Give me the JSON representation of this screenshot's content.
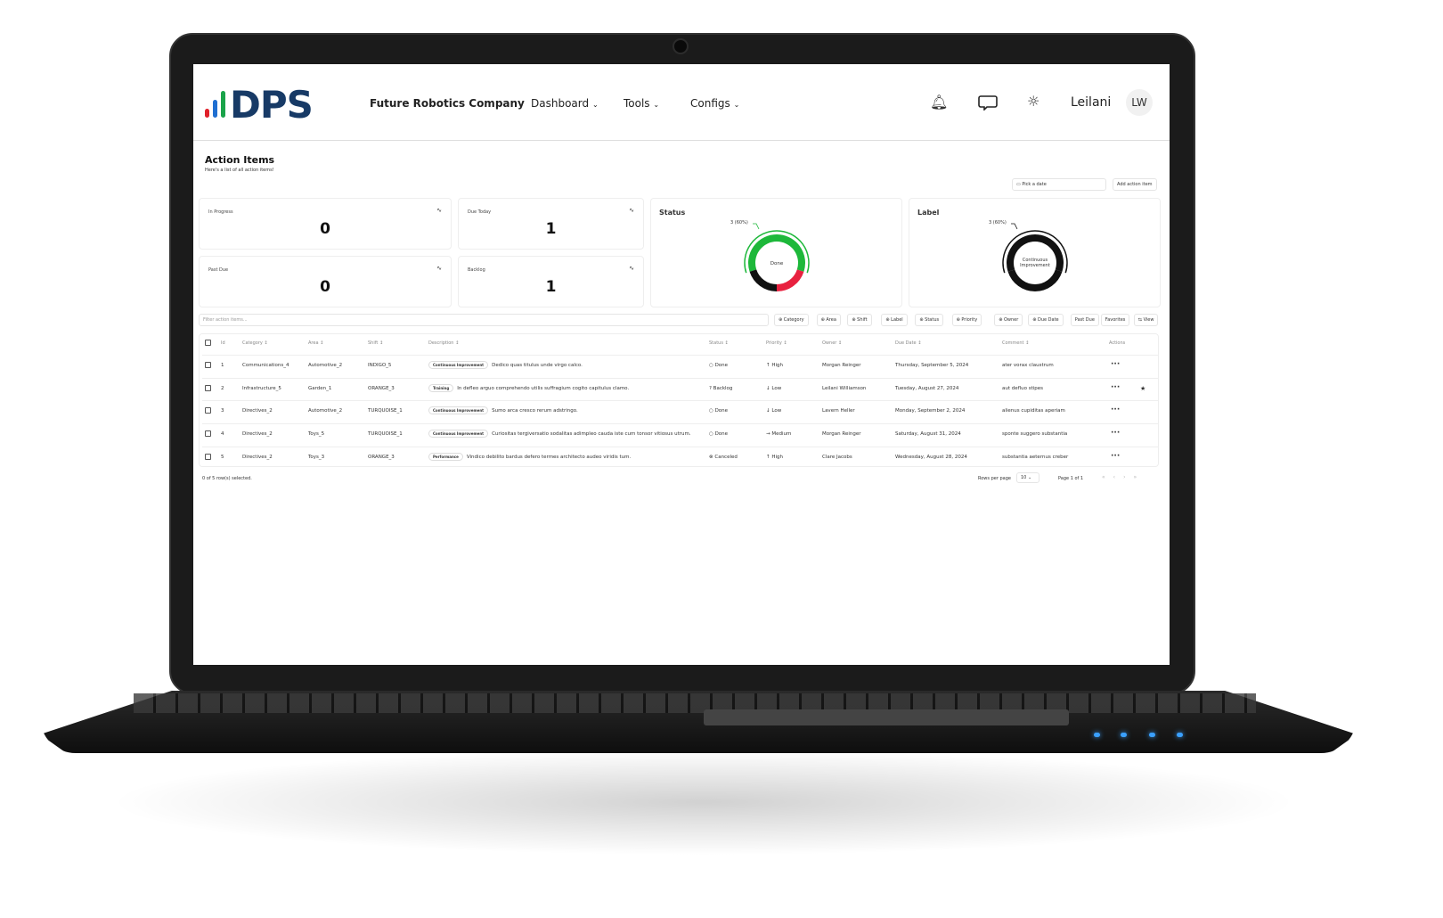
{
  "header": {
    "logo_text": "DPS",
    "company": "Future Robotics Company",
    "nav": [
      {
        "label": "Dashboard"
      },
      {
        "label": "Tools"
      },
      {
        "label": "Configs"
      }
    ],
    "icons": [
      "bell-icon",
      "message-icon",
      "sun-icon"
    ],
    "user_name": "Leilani",
    "avatar_initials": "LW"
  },
  "page": {
    "title": "Action Items",
    "subtitle": "Here's a list of all action items!",
    "date_picker": "Pick a date",
    "add_button": "Add action item"
  },
  "stats": [
    {
      "label": "In Progress",
      "value": "0"
    },
    {
      "label": "Due Today",
      "value": "1"
    },
    {
      "label": "Past Due",
      "value": "0"
    },
    {
      "label": "Backlog",
      "value": "1"
    }
  ],
  "charts": {
    "status": {
      "title": "Status",
      "center": "Done",
      "callout": "3 (60%)"
    },
    "label": {
      "title": "Label",
      "center_line1": "Continuous",
      "center_line2": "Improvement",
      "callout": "3 (60%)"
    }
  },
  "chart_data": [
    {
      "type": "pie",
      "title": "Status",
      "categories": [
        "Done",
        "Canceled",
        "Backlog"
      ],
      "values": [
        3,
        1,
        1
      ],
      "colors": [
        "#1db83a",
        "#e8213f",
        "#111111"
      ],
      "annotation": "3 (60%)"
    },
    {
      "type": "pie",
      "title": "Label",
      "categories": [
        "Continuous Improvement",
        "Training",
        "Performance"
      ],
      "values": [
        3,
        1,
        1
      ],
      "colors": [
        "#111111",
        "#111111",
        "#111111"
      ],
      "annotation": "3 (60%)"
    }
  ],
  "filter": {
    "placeholder": "Filter action items...",
    "buttons": [
      "Category",
      "Area",
      "Shift",
      "Label",
      "Status",
      "Priority",
      "Owner",
      "Due Date"
    ],
    "past_due": "Past Due",
    "favorites": "Favorites",
    "view": "View"
  },
  "table": {
    "columns": [
      "Id",
      "Category",
      "Area",
      "Shift",
      "Description",
      "Status",
      "Priority",
      "Owner",
      "Due Date",
      "Comment",
      "Actions"
    ],
    "rows": [
      {
        "id": "1",
        "category": "Communications_4",
        "area": "Automotive_2",
        "shift": "INDIGO_5",
        "label": "Continuous Improvement",
        "description": "Dedico quas titulus unde virgo calco.",
        "status": "Done",
        "status_icon": "○",
        "priority": "High",
        "priority_icon": "↑",
        "owner": "Morgan Reinger",
        "due": "Thursday, September 5, 2024",
        "comment": "ater vorax claustrum",
        "favorite": false
      },
      {
        "id": "2",
        "category": "Infrastructure_5",
        "area": "Garden_1",
        "shift": "ORANGE_3",
        "label": "Training",
        "description": "In defleo arguo comprehendo utilis suffragium cogito capitulus clamo.",
        "status": "Backlog",
        "status_icon": "?",
        "priority": "Low",
        "priority_icon": "↓",
        "owner": "Leilani Williamson",
        "due": "Tuesday, August 27, 2024",
        "comment": "aut defluo stipes",
        "favorite": true
      },
      {
        "id": "3",
        "category": "Directives_2",
        "area": "Automotive_2",
        "shift": "TURQUOISE_1",
        "label": "Continuous Improvement",
        "description": "Sumo arca cresco rerum adstringo.",
        "status": "Done",
        "status_icon": "○",
        "priority": "Low",
        "priority_icon": "↓",
        "owner": "Lavern Heller",
        "due": "Monday, September 2, 2024",
        "comment": "alienus cupiditas aperiam",
        "favorite": false
      },
      {
        "id": "4",
        "category": "Directives_2",
        "area": "Toys_5",
        "shift": "TURQUOISE_1",
        "label": "Continuous Improvement",
        "description": "Curiositas tergiversatio sodalitas adimpleo cauda iste cum tonsor vitiosus utrum.",
        "status": "Done",
        "status_icon": "○",
        "priority": "Medium",
        "priority_icon": "→",
        "owner": "Morgan Reinger",
        "due": "Saturday, August 31, 2024",
        "comment": "sponte suggero substantia",
        "favorite": false
      },
      {
        "id": "5",
        "category": "Directives_2",
        "area": "Toys_3",
        "shift": "ORANGE_3",
        "label": "Performance",
        "description": "Vindico debilito bardus defero termes architecto audeo viridis tum.",
        "status": "Canceled",
        "status_icon": "⊗",
        "priority": "High",
        "priority_icon": "↑",
        "owner": "Clare Jacobs",
        "due": "Wednesday, August 28, 2024",
        "comment": "substantia aeternus creber",
        "favorite": false
      }
    ]
  },
  "footer": {
    "selected": "0 of 5 row(s) selected.",
    "rows_per_page_label": "Rows per page",
    "rows_per_page": "10",
    "page": "Page 1 of 1"
  }
}
